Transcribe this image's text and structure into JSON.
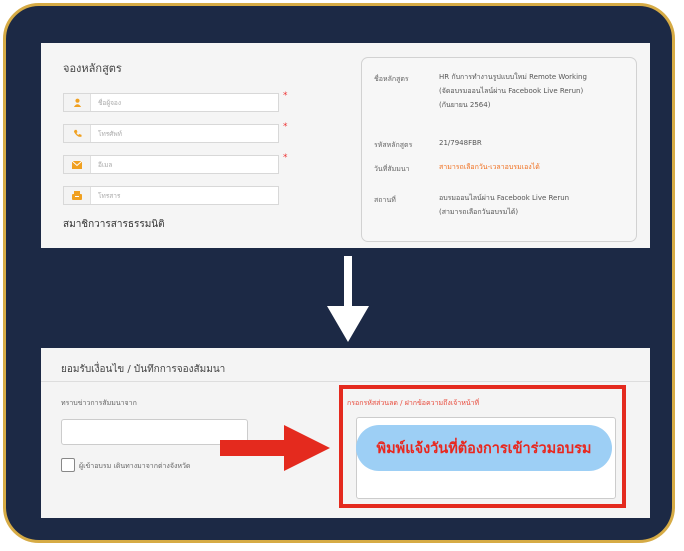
{
  "top_panel": {
    "section_title": "จองหลักสูตร",
    "fields": [
      {
        "placeholder": "ชื่อผู้จอง",
        "icon": "user-icon",
        "required": true
      },
      {
        "placeholder": "โทรศัพท์",
        "icon": "phone-icon",
        "required": true
      },
      {
        "placeholder": "อีเมล",
        "icon": "mail-icon",
        "required": true
      },
      {
        "placeholder": "โทรสาร",
        "icon": "fax-icon",
        "required": false
      }
    ],
    "required_mark": "*",
    "membership_label": "สมาชิกวารสารธรรมนิติ",
    "course_info": {
      "course_name_label": "ชื่อหลักสูตร",
      "course_name_lines": [
        "HR กับการทำงานรูปแบบใหม่ Remote Working",
        "(จัดอบรมออนไลน์ผ่าน Facebook Live Rerun)",
        "(กันยายน 2564)"
      ],
      "course_code_label": "รหัสหลักสูตร",
      "course_code": "21/7948FBR",
      "date_label": "วันที่สัมมนา",
      "date_value": "สามารถเลือกวัน-เวลาอบรมเองได้",
      "venue_label": "สถานที่",
      "venue_lines": [
        "อบรมออนไลน์ผ่าน Facebook Live Rerun",
        "(สามารถเลือกวันอบรมได้)"
      ]
    }
  },
  "bottom_panel": {
    "section_title": "ยอมรับเงื่อนไข / บันทึกการจองสัมมนา",
    "source_label": "ทราบข่าวการสัมมนาจาก",
    "checkbox_label": "ผู้เข้าอบรม เดินทางมาจากต่างจังหวัด",
    "note_label": "กรอกรหัสส่วนลด / ฝากข้อความถึงเจ้าหน้าที่",
    "callout": "พิมพ์แจ้งวันที่ต้องการเข้าร่วมอบรม"
  },
  "colors": {
    "frame_bg": "#1c2945",
    "frame_border": "#d6ab45",
    "accent_red": "#e42a1e",
    "pill_bg": "#9dcff5",
    "orange": "#f07020"
  }
}
